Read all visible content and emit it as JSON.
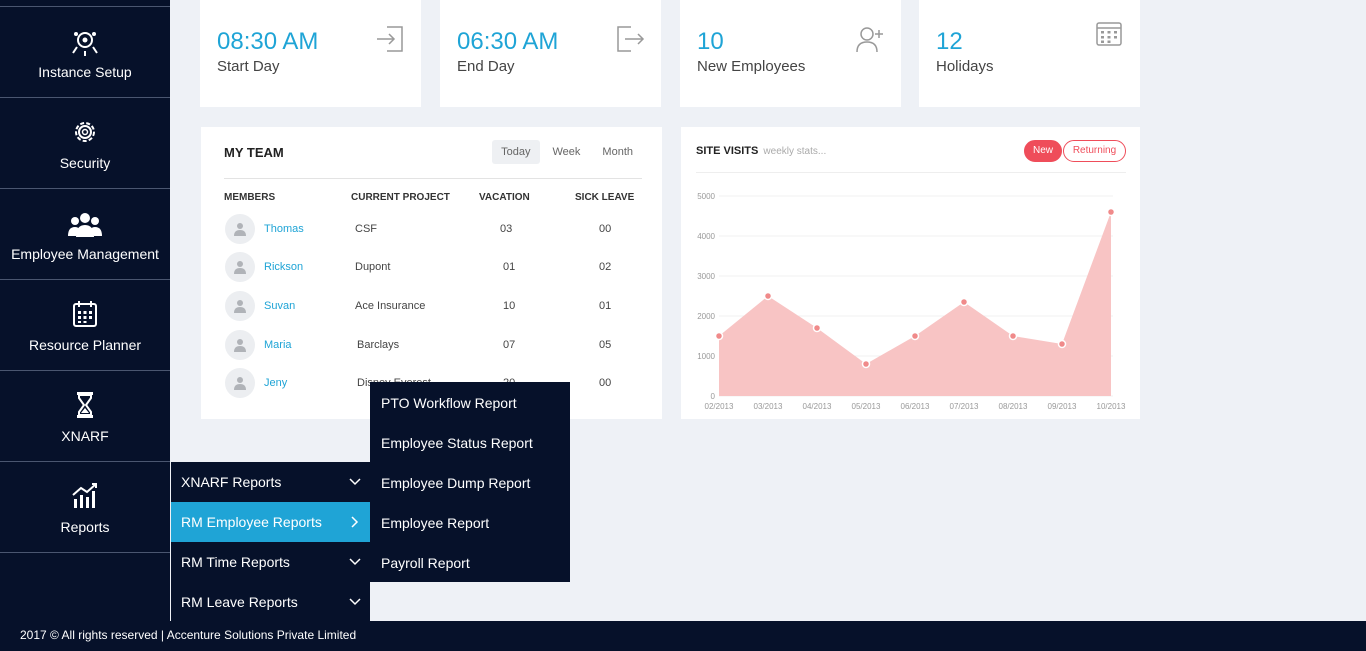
{
  "sidebar": {
    "items": [
      {
        "label": "Instance Setup",
        "icon": "instance-setup-icon"
      },
      {
        "label": "Security",
        "icon": "gear-icon"
      },
      {
        "label": "Employee Management",
        "icon": "users-group-icon"
      },
      {
        "label": "Resource Planner",
        "icon": "calendar-icon"
      },
      {
        "label": "XNARF",
        "icon": "hourglass-icon"
      },
      {
        "label": "Reports",
        "icon": "bar-chart-icon"
      }
    ]
  },
  "stats": [
    {
      "value": "08:30 AM",
      "caption": "Start Day",
      "icon": "sign-in-icon"
    },
    {
      "value": "06:30 AM",
      "caption": "End Day",
      "icon": "sign-out-icon"
    },
    {
      "value": "10",
      "caption": "New Employees",
      "icon": "add-user-icon"
    },
    {
      "value": "12",
      "caption": "Holidays",
      "icon": "calendar-icon"
    }
  ],
  "team": {
    "title": "MY TEAM",
    "tabs": [
      "Today",
      "Week",
      "Month"
    ],
    "active_tab": "Today",
    "columns": [
      "MEMBERS",
      "CURRENT PROJECT",
      "VACATION",
      "SICK LEAVE"
    ],
    "rows": [
      {
        "name": "Thomas",
        "project": "CSF",
        "vacation": "03",
        "sick": "00"
      },
      {
        "name": "Rickson",
        "project": "Dupont",
        "vacation": "01",
        "sick": "02"
      },
      {
        "name": "Suvan",
        "project": "Ace Insurance",
        "vacation": "10",
        "sick": "01"
      },
      {
        "name": "Maria",
        "project": "Barclays",
        "vacation": "07",
        "sick": "05"
      },
      {
        "name": "Jeny",
        "project": "Disney Everest",
        "vacation": "20",
        "sick": "00"
      }
    ]
  },
  "visits": {
    "title": "SITE VISITS",
    "subtitle": "weekly stats...",
    "pill_new": "New",
    "pill_returning": "Returning"
  },
  "chart_data": {
    "type": "area",
    "x": [
      "02/2013",
      "03/2013",
      "04/2013",
      "05/2013",
      "06/2013",
      "07/2013",
      "08/2013",
      "09/2013",
      "10/2013"
    ],
    "values": [
      1500,
      2500,
      1700,
      800,
      1500,
      2350,
      1500,
      1300,
      4600
    ],
    "yticks": [
      0,
      1000,
      2000,
      3000,
      4000,
      5000
    ],
    "ylim": [
      0,
      5000
    ],
    "fill_color": "#f8c4c4",
    "point_color": "#f08a8a"
  },
  "menu_reports": {
    "items": [
      {
        "label": "XNARF Reports",
        "chevron": "chevron-down-icon"
      },
      {
        "label": "RM Employee Reports",
        "chevron": "chevron-right-icon"
      },
      {
        "label": "RM Time Reports",
        "chevron": "chevron-down-icon"
      },
      {
        "label": "RM Leave Reports",
        "chevron": "chevron-down-icon"
      }
    ],
    "active_index": 1
  },
  "menu_employee_reports": {
    "items": [
      "PTO Workflow Report",
      "Employee Status Report",
      "Employee Dump Report",
      "Employee Report",
      "Payroll Report"
    ]
  },
  "footer": {
    "text": "2017 © All rights reserved | Accenture Solutions Private Limited"
  },
  "colors": {
    "accent": "#1fa4d6",
    "navy": "#06112a",
    "danger": "#ef4d5a"
  }
}
